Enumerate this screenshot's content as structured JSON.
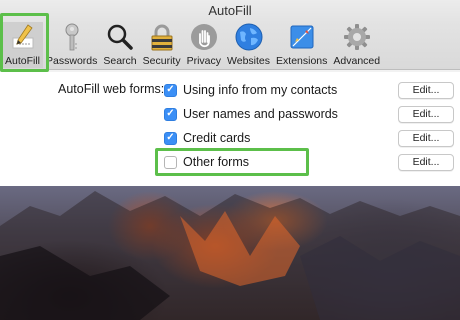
{
  "window": {
    "title": "AutoFill"
  },
  "toolbar": {
    "items": [
      {
        "label": "AutoFill",
        "icon": "pencil-icon"
      },
      {
        "label": "Passwords",
        "icon": "key-icon"
      },
      {
        "label": "Search",
        "icon": "magnifier-icon"
      },
      {
        "label": "Security",
        "icon": "padlock-icon"
      },
      {
        "label": "Privacy",
        "icon": "hand-icon"
      },
      {
        "label": "Websites",
        "icon": "globe-icon"
      },
      {
        "label": "Extensions",
        "icon": "puzzle-icon"
      },
      {
        "label": "Advanced",
        "icon": "gear-icon"
      }
    ],
    "active": "AutoFill"
  },
  "autofill": {
    "section_label": "AutoFill web forms:",
    "options": [
      {
        "label": "Using info from my contacts",
        "checked": true,
        "button": "Edit..."
      },
      {
        "label": "User names and passwords",
        "checked": true,
        "button": "Edit..."
      },
      {
        "label": "Credit cards",
        "checked": true,
        "button": "Edit..."
      },
      {
        "label": "Other forms",
        "checked": false,
        "button": "Edit..."
      }
    ]
  },
  "colors": {
    "highlight": "#5cbf4a",
    "checkbox": "#3b8ff6",
    "window_bg": "#f2f2f2"
  }
}
